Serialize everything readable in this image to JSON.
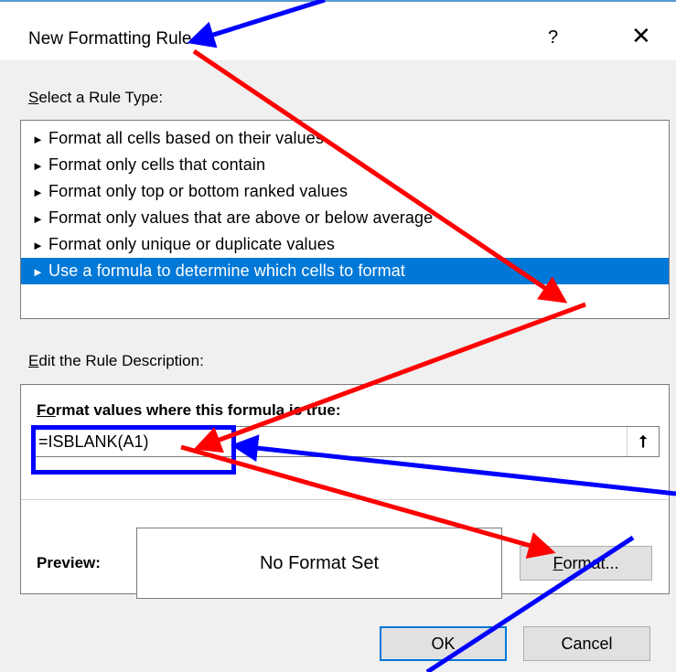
{
  "dialog": {
    "title": "New Formatting Rule",
    "help_glyph": "?",
    "close_glyph": "✕"
  },
  "rule_type": {
    "label_first": "S",
    "label_rest": "elect a Rule Type:",
    "items": [
      {
        "label": "Format all cells based on their values",
        "selected": false
      },
      {
        "label": "Format only cells that contain",
        "selected": false
      },
      {
        "label": "Format only top or bottom ranked values",
        "selected": false
      },
      {
        "label": "Format only values that are above or below average",
        "selected": false
      },
      {
        "label": "Format only unique or duplicate values",
        "selected": false
      },
      {
        "label": "Use a formula to determine which cells to format",
        "selected": true
      }
    ]
  },
  "description": {
    "label_first": "E",
    "label_rest": "dit the Rule Description:",
    "formula_label_first": "F",
    "formula_label_o": "o",
    "formula_label_rest": "rmat values where this formula is true:",
    "formula_value": "=ISBLANK(A1)",
    "collapse_glyph": "⭡",
    "preview_label": "Preview:",
    "preview_text": "No Format Set",
    "format_button_first": "F",
    "format_button_rest": "ormat..."
  },
  "buttons": {
    "ok": "OK",
    "cancel": "Cancel"
  },
  "colors": {
    "selection": "#0078d7",
    "annotation_red": "#ff0000",
    "annotation_blue": "#0000ff"
  }
}
